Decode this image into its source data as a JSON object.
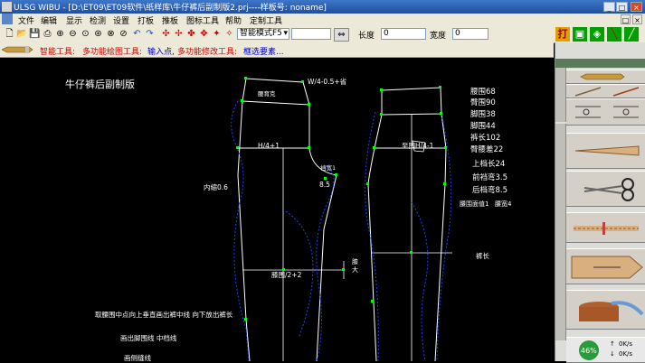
{
  "window": {
    "title": "ULSG WIBU - [D:\\ET09\\ET09软件\\纸样库\\牛仔裤后副制版2.prj----样板号: noname]",
    "buttons": [
      "_",
      "□",
      "×"
    ]
  },
  "menu": [
    "文件",
    "编辑",
    "显示",
    "检测",
    "设置",
    "打板",
    "推板",
    "图标工具",
    "帮助",
    "定制工具"
  ],
  "toolbar": {
    "mode_select": "智能模式F5",
    "length_label": "长度",
    "length_value": "0",
    "width_label": "宽度",
    "width_value": "0",
    "right_buttons": [
      "打"
    ]
  },
  "hint": {
    "smart_tool": "智能工具:",
    "multi_draw": "多功能绘图工具:",
    "input_point": "输入点,",
    "multi_modify": "多功能修改工具:",
    "select_element": "框选要素..."
  },
  "canvas": {
    "title": "牛仔裤后副制版",
    "measurements": [
      "腰围68",
      "臀围90",
      "脚围38",
      "脚围44",
      "裤长102",
      "臀腰差22",
      "上档长24",
      "前裆弯3.5",
      "后档弯8.5",
      "腰围面值1",
      "腰宽4"
    ],
    "labels": {
      "waist_top": "W/4-0.5+省",
      "yoke": "腰育克",
      "hip_quarter": "H/4+1",
      "front_hip": "至围H/4-1",
      "knee": "膝围/2+2",
      "inseam_left": "内缩0.6",
      "dim_8_5": "8.5",
      "crotch_width": "裆宽1",
      "pants_length": "裤长",
      "knee_mark": "膝",
      "mark_lower": "大"
    },
    "notes": [
      "取腰围中点向上垂直画出裤中线 向下放出裤长",
      "画出脚围线 中档线",
      "画侧缝线"
    ]
  },
  "right_panel": {
    "progress_percent": "46%",
    "speed_up": "0K/s",
    "speed_down": "0K/s"
  },
  "colors": {
    "canvas": "#000000",
    "line": "#ffffff",
    "point": "#00ff00",
    "dashed": "#2040ff",
    "hint_red": "#cc0000",
    "hint_blue": "#0000cc"
  }
}
